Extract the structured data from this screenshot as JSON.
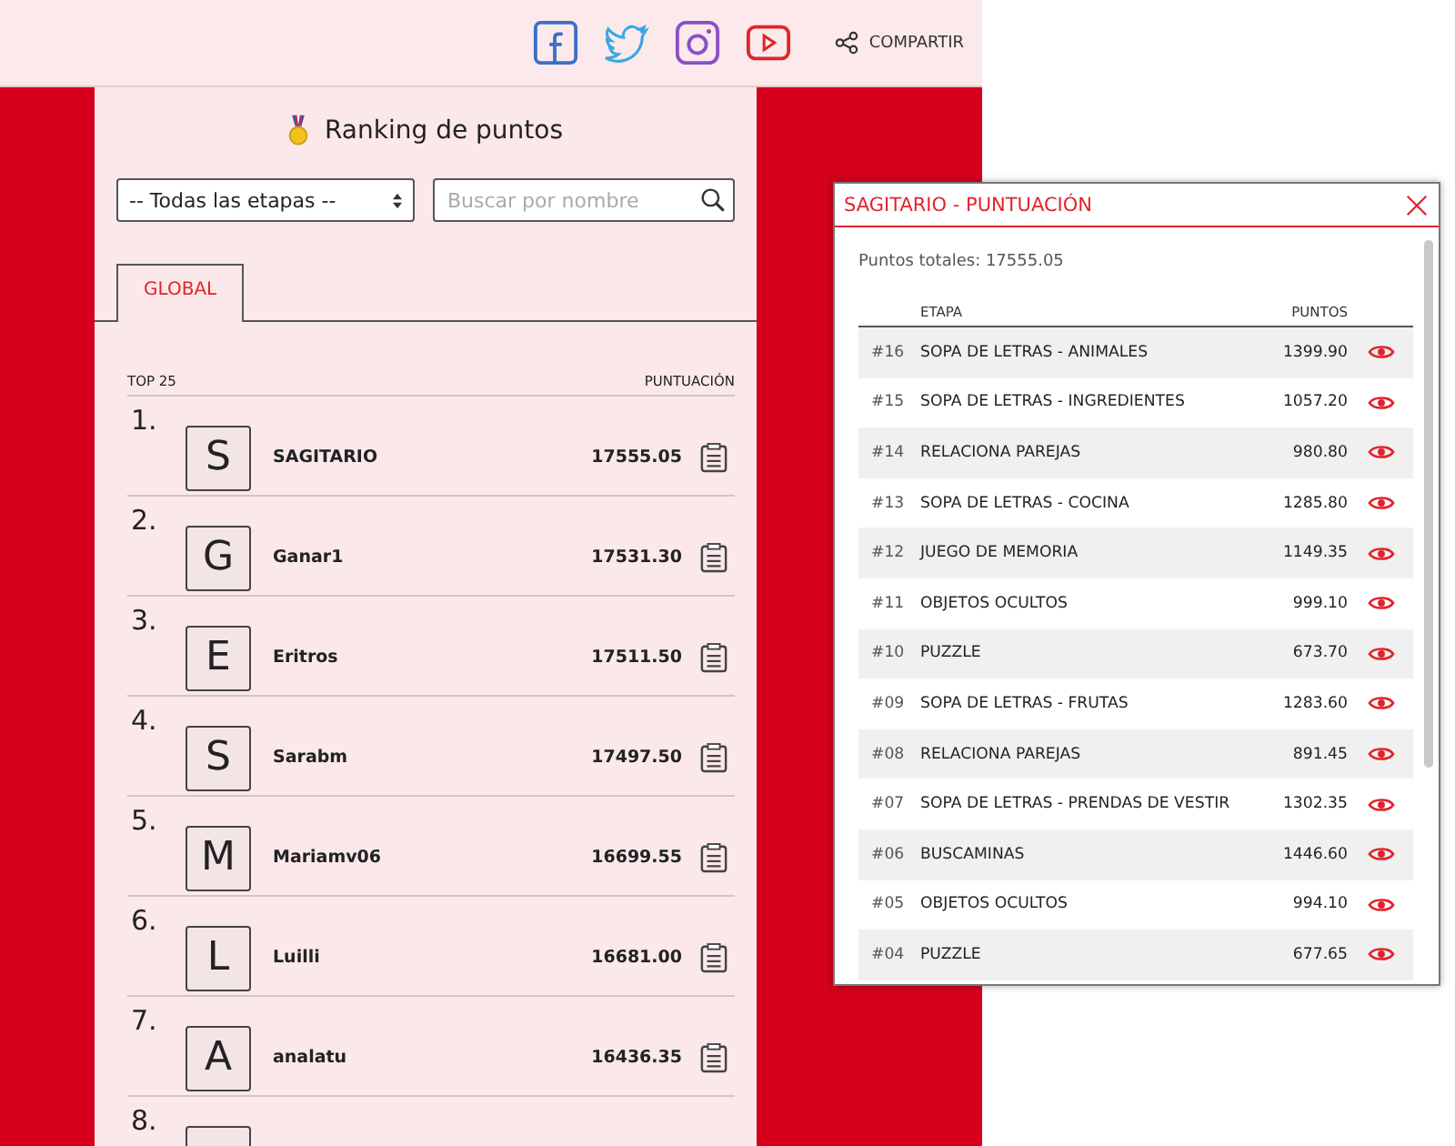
{
  "header": {
    "share_label": "COMPARTIR"
  },
  "ranking": {
    "title": "Ranking de puntos",
    "stage_select": {
      "value": "-- Todas las etapas --"
    },
    "search": {
      "placeholder": "Buscar por nombre"
    },
    "tabs": [
      {
        "label": "GLOBAL",
        "selected": true
      }
    ],
    "columns": [
      "TOP 25",
      "PUNTUACIÓN"
    ],
    "rows": [
      {
        "rank": "1.",
        "initial": "S",
        "name": "SAGITARIO",
        "score": "17555.05"
      },
      {
        "rank": "2.",
        "initial": "G",
        "name": "Ganar1",
        "score": "17531.30"
      },
      {
        "rank": "3.",
        "initial": "E",
        "name": "Eritros",
        "score": "17511.50"
      },
      {
        "rank": "4.",
        "initial": "S",
        "name": "Sarabm",
        "score": "17497.50"
      },
      {
        "rank": "5.",
        "initial": "M",
        "name": "Mariamv06",
        "score": "16699.55"
      },
      {
        "rank": "6.",
        "initial": "L",
        "name": "Luilli",
        "score": "16681.00"
      },
      {
        "rank": "7.",
        "initial": "A",
        "name": "analatu",
        "score": "16436.35"
      },
      {
        "rank": "8."
      }
    ]
  },
  "popup": {
    "title": "SAGITARIO - PUNTUACIÓN",
    "total": "Puntos totales: 17555.05",
    "columns": [
      "ETAPA",
      "PUNTOS"
    ],
    "rows": [
      {
        "id": "#16",
        "stage": "SOPA DE LETRAS - ANIMALES",
        "points": "1399.90"
      },
      {
        "id": "#15",
        "stage": "SOPA DE LETRAS - INGREDIENTES",
        "points": "1057.20"
      },
      {
        "id": "#14",
        "stage": "RELACIONA PAREJAS",
        "points": "980.80"
      },
      {
        "id": "#13",
        "stage": "SOPA DE LETRAS - COCINA",
        "points": "1285.80"
      },
      {
        "id": "#12",
        "stage": "JUEGO DE MEMORIA",
        "points": "1149.35"
      },
      {
        "id": "#11",
        "stage": "OBJETOS OCULTOS",
        "points": "999.10"
      },
      {
        "id": "#10",
        "stage": "PUZZLE",
        "points": "673.70"
      },
      {
        "id": "#09",
        "stage": "SOPA DE LETRAS - FRUTAS",
        "points": "1283.60"
      },
      {
        "id": "#08",
        "stage": "RELACIONA PAREJAS",
        "points": "891.45"
      },
      {
        "id": "#07",
        "stage": "SOPA DE LETRAS - PRENDAS DE VESTIR",
        "points": "1302.35"
      },
      {
        "id": "#06",
        "stage": "BUSCAMINAS",
        "points": "1446.60"
      },
      {
        "id": "#05",
        "stage": "OBJETOS OCULTOS",
        "points": "994.10"
      },
      {
        "id": "#04",
        "stage": "PUZZLE",
        "points": "677.65"
      }
    ]
  }
}
